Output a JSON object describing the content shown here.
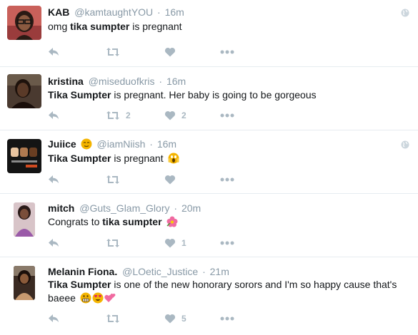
{
  "tweets": [
    {
      "name": "KAB",
      "handle": "@kamtaughtYOU",
      "time": "16m",
      "text_before": "omg ",
      "bold": "tika sumpter",
      "text_after": " is pregnant",
      "retweets": "",
      "likes": "",
      "avatar_color": "#c05a55",
      "avatar_icon": "woman-glasses-avatar"
    },
    {
      "name": "kristina",
      "handle": "@miseduofkris",
      "time": "16m",
      "text_before": "",
      "bold": "Tika Sumpter",
      "text_after": " is pregnant. Her baby is going to be gorgeous",
      "retweets": "2",
      "likes": "2",
      "avatar_color": "#3a2a22",
      "avatar_icon": "woman-avatar"
    },
    {
      "name": "Juiice",
      "handle": "@iamNiish",
      "time": "16m",
      "text_before": "",
      "bold": "Tika Sumpter",
      "text_after": " is pregnant",
      "retweets": "",
      "likes": "",
      "avatar_color": "#1a1a1a",
      "avatar_icon": "fists-avatar",
      "name_emoji": "relieved-emoji",
      "text_emoji": "scream-emoji"
    },
    {
      "name": "mitch",
      "handle": "@Guts_Glam_Glory",
      "time": "20m",
      "text_before": "Congrats to ",
      "bold": "tika sumpter",
      "text_after": "",
      "retweets": "",
      "likes": "1",
      "avatar_color": "#b89aa0",
      "avatar_icon": "woman-avatar",
      "text_emoji": "hibiscus-emoji"
    },
    {
      "name": "Melanin Fiona.",
      "handle": "@LOetic_Justice",
      "time": "21m",
      "text_before": "",
      "bold": "Tika Sumpter",
      "text_after": " is one of the new honorary sorors and I'm so happy cause that's baeee",
      "retweets": "",
      "likes": "5",
      "avatar_color": "#6b4a3a",
      "avatar_icon": "woman-avatar",
      "text_emoji": "grimace-heart-eyes-hearts-emoji"
    }
  ],
  "colors": {
    "icon": "#aab8c2",
    "meta": "#8899a6",
    "divider": "#e6ecf0"
  }
}
